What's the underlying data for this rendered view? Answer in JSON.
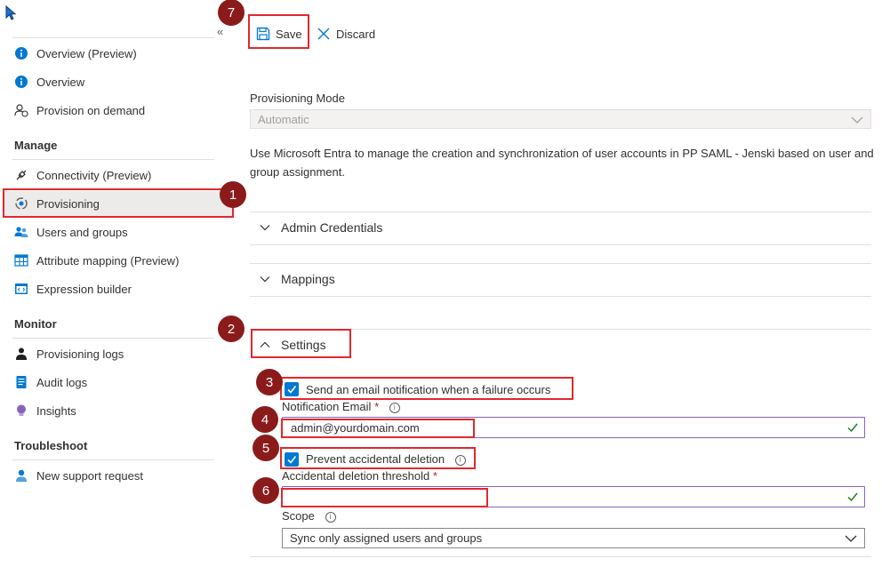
{
  "sidebar": {
    "collapse_glyph": "«",
    "items_top": [
      {
        "label": "Overview (Preview)",
        "icon": "info-icon"
      },
      {
        "label": "Overview",
        "icon": "info-icon"
      },
      {
        "label": "Provision on demand",
        "icon": "person-sync-icon"
      }
    ],
    "sections": {
      "manage": "Manage",
      "monitor": "Monitor",
      "troubleshoot": "Troubleshoot"
    },
    "manage_items": [
      {
        "label": "Connectivity (Preview)",
        "icon": "plug-icon"
      },
      {
        "label": "Provisioning",
        "icon": "provisioning-icon",
        "selected": true
      },
      {
        "label": "Users and groups",
        "icon": "users-icon"
      },
      {
        "label": "Attribute mapping (Preview)",
        "icon": "table-icon"
      },
      {
        "label": "Expression builder",
        "icon": "code-icon"
      }
    ],
    "monitor_items": [
      {
        "label": "Provisioning logs",
        "icon": "person-log-icon"
      },
      {
        "label": "Audit logs",
        "icon": "audit-log-icon"
      },
      {
        "label": "Insights",
        "icon": "bulb-icon"
      }
    ],
    "troubleshoot_items": [
      {
        "label": "New support request",
        "icon": "support-person-icon"
      }
    ]
  },
  "toolbar": {
    "save_label": "Save",
    "discard_label": "Discard"
  },
  "form": {
    "provisioning_mode_label": "Provisioning Mode",
    "provisioning_mode_value": "Automatic",
    "description": "Use Microsoft Entra to manage the creation and synchronization of user accounts in PP SAML - Jenski based on user and group assignment.",
    "accordions": {
      "admin_credentials": "Admin Credentials",
      "mappings": "Mappings",
      "settings": "Settings"
    },
    "email_notification_label": "Send an email notification when a failure occurs",
    "email_notification_checked": true,
    "notification_email_label": "Notification Email",
    "notification_email_value": "admin@yourdomain.com",
    "prevent_deletion_label": "Prevent accidental deletion",
    "prevent_deletion_checked": true,
    "deletion_threshold_label": "Accidental deletion threshold",
    "deletion_threshold_value": "",
    "scope_label": "Scope",
    "scope_value": "Sync only assigned users and groups",
    "required_marker": "*",
    "info_glyph": "i"
  },
  "annotations": [
    "1",
    "2",
    "3",
    "4",
    "5",
    "6",
    "7"
  ],
  "colors": {
    "accent": "#0078d4",
    "annotation_box": "#e0282e",
    "annotation_badge": "#8b1b1b",
    "input_border": "#8764b8",
    "valid_check": "#107c10"
  }
}
